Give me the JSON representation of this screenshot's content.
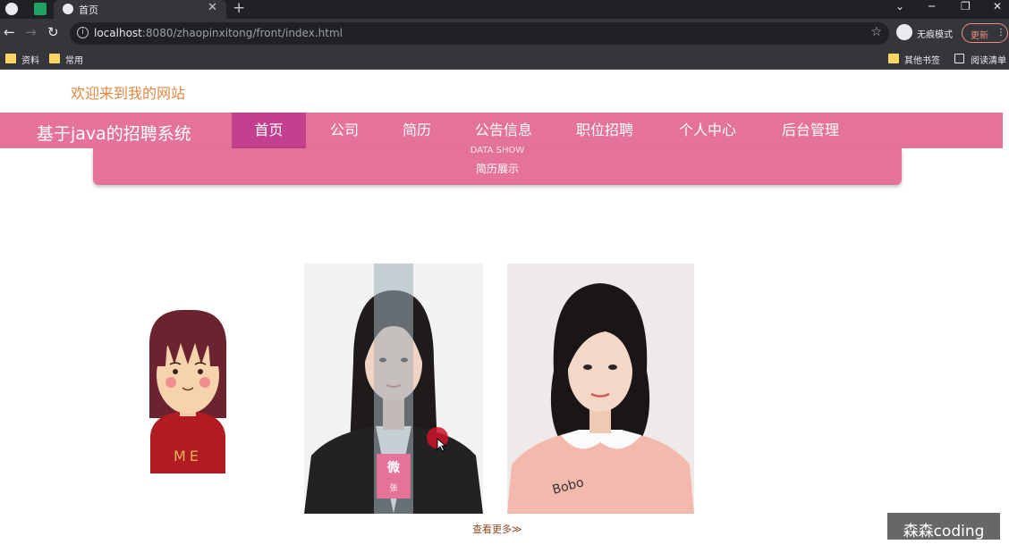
{
  "browser": {
    "tab_title": "首页",
    "new_tab_label": "+",
    "close_tab_label": "✕",
    "url_host": "localhost",
    "url_rest": ":8080/zhaopinxitong/front/index.html",
    "incognito_label": "无痕模式",
    "update_label": "更新",
    "bookmarks": [
      {
        "label": "资料"
      },
      {
        "label": "常用"
      },
      {
        "label": "其他书签"
      },
      {
        "label": "阅读清单"
      }
    ],
    "colors": {
      "tabbar": "#202124",
      "toolbar": "#35363a",
      "folder": "#fdd663"
    }
  },
  "page": {
    "welcome": "欢迎来到我的网站",
    "site_title": "基于java的招聘系统",
    "nav": [
      {
        "label": "首页",
        "active": true
      },
      {
        "label": "公司"
      },
      {
        "label": "简历"
      },
      {
        "label": "公告信息"
      },
      {
        "label": "职位招聘"
      },
      {
        "label": "个人中心"
      },
      {
        "label": "后台管理"
      }
    ],
    "banner": {
      "en": "DATA SHOW",
      "zh": "简历展示"
    },
    "card1": {
      "shirt_text": "ME"
    },
    "hover": {
      "btn_main": "微",
      "btn_sub": "张"
    },
    "card3": {
      "shirt_text": "Bobo"
    },
    "more_link": "查看更多≫",
    "watermark": "森森coding",
    "colors": {
      "accent": "#e57398",
      "active": "#c2408f",
      "welcome": "#e2873f"
    }
  }
}
